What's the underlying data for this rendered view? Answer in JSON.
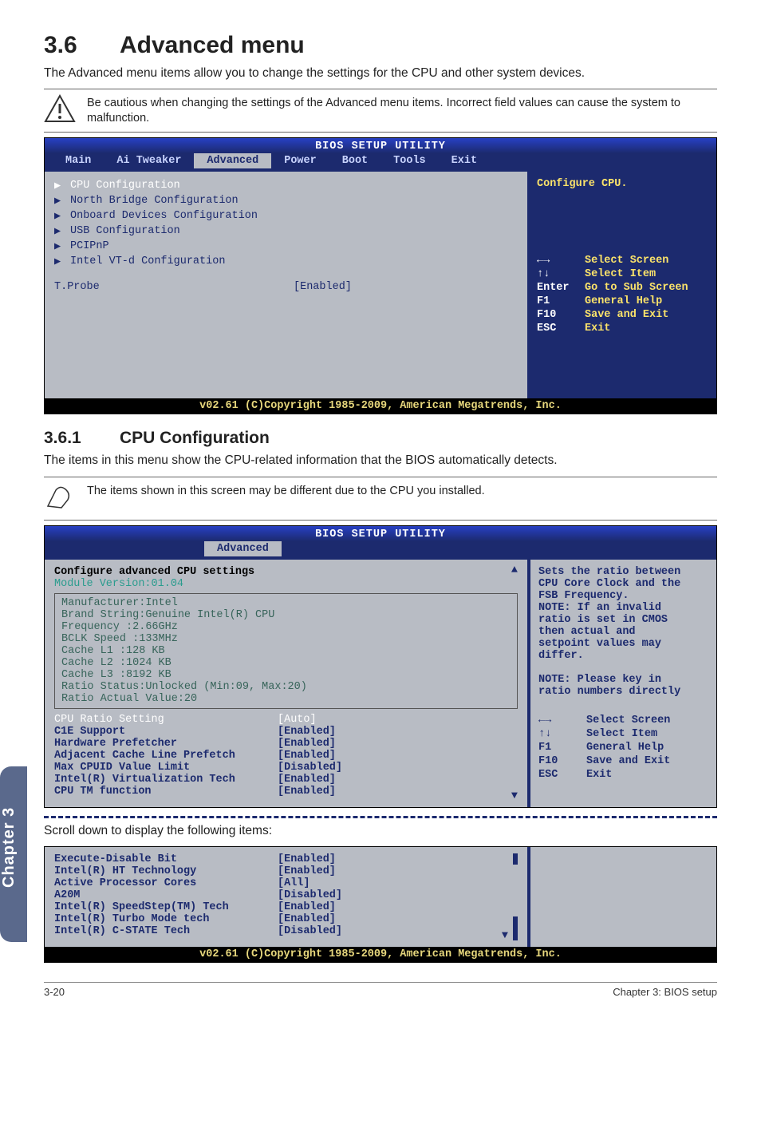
{
  "section": {
    "number": "3.6",
    "title": "Advanced menu",
    "intro": "The Advanced menu items allow you to change the settings for the CPU and other system devices.",
    "caution": "Be cautious when changing the settings of the Advanced menu items. Incorrect field values can cause the system to malfunction."
  },
  "bios1": {
    "title": "BIOS SETUP UTILITY",
    "tabs": [
      "Main",
      "Ai Tweaker",
      "Advanced",
      "Power",
      "Boot",
      "Tools",
      "Exit"
    ],
    "active_tab": "Advanced",
    "items": [
      "CPU Configuration",
      "North Bridge Configuration",
      "Onboard Devices Configuration",
      "USB Configuration",
      "PCIPnP",
      "Intel VT-d Configuration"
    ],
    "tprobe": {
      "label": "T.Probe",
      "value": "[Enabled]"
    },
    "right_help": "Configure CPU.",
    "keys": [
      {
        "k": "←→",
        "d": "Select Screen"
      },
      {
        "k": "↑↓",
        "d": "Select Item"
      },
      {
        "k": "Enter",
        "d": "Go to Sub Screen"
      },
      {
        "k": "F1",
        "d": "General Help"
      },
      {
        "k": "F10",
        "d": "Save and Exit"
      },
      {
        "k": "ESC",
        "d": "Exit"
      }
    ],
    "footer": "v02.61 (C)Copyright 1985-2009, American Megatrends, Inc."
  },
  "sub": {
    "number": "3.6.1",
    "title": "CPU Configuration",
    "intro": "The items in this menu show the CPU-related information that the BIOS automatically detects.",
    "note": "The items shown in this screen may be different due to the CPU you installed."
  },
  "chart_data": {
    "type": "table",
    "title": "BIOS Advanced / CPU Configuration settings",
    "sections": {
      "advanced_menu_items": [
        {
          "name": "CPU Configuration",
          "type": "submenu"
        },
        {
          "name": "North Bridge Configuration",
          "type": "submenu"
        },
        {
          "name": "Onboard Devices Configuration",
          "type": "submenu"
        },
        {
          "name": "USB Configuration",
          "type": "submenu"
        },
        {
          "name": "PCIPnP",
          "type": "submenu"
        },
        {
          "name": "Intel VT-d Configuration",
          "type": "submenu"
        },
        {
          "name": "T.Probe",
          "value": "Enabled"
        }
      ],
      "cpu_info": {
        "Module Version": "01.04",
        "Manufacturer": "Intel",
        "Brand String": "Genuine Intel(R) CPU",
        "Frequency": "2.66GHz",
        "BCLK Speed": "133MHz",
        "Cache L1": "128 KB",
        "Cache L2": "1024 KB",
        "Cache L3": "8192 KB",
        "Ratio Status": "Unlocked (Min:09, Max:20)",
        "Ratio Actual Value": "20"
      },
      "cpu_settings": [
        {
          "name": "CPU Ratio Setting",
          "value": "Auto"
        },
        {
          "name": "C1E Support",
          "value": "Enabled"
        },
        {
          "name": "Hardware Prefetcher",
          "value": "Enabled"
        },
        {
          "name": "Adjacent Cache Line Prefetch",
          "value": "Enabled"
        },
        {
          "name": "Max CPUID Value Limit",
          "value": "Disabled"
        },
        {
          "name": "Intel(R) Virtualization Tech",
          "value": "Enabled"
        },
        {
          "name": "CPU TM function",
          "value": "Enabled"
        },
        {
          "name": "Execute-Disable Bit",
          "value": "Enabled"
        },
        {
          "name": "Intel(R) HT Technology",
          "value": "Enabled"
        },
        {
          "name": "Active Processor Cores",
          "value": "All"
        },
        {
          "name": "A20M",
          "value": "Disabled"
        },
        {
          "name": "Intel(R) SpeedStep(TM) Tech",
          "value": "Enabled"
        },
        {
          "name": "Intel(R) Turbo Mode tech",
          "value": "Enabled"
        },
        {
          "name": "Intel(R) C-STATE Tech",
          "value": "Disabled"
        }
      ]
    }
  },
  "bios2": {
    "title": "BIOS SETUP UTILITY",
    "active_tab": "Advanced",
    "header": "Configure advanced CPU settings",
    "module": "Module Version:01.04",
    "info": [
      "Manufacturer:Intel",
      "Brand String:Genuine Intel(R) CPU",
      "Frequency   :2.66GHz",
      "BCLK Speed  :133MHz",
      "Cache L1    :128 KB",
      "Cache L2    :1024 KB",
      "Cache L3    :8192 KB",
      "Ratio Status:Unlocked (Min:09, Max:20)",
      "Ratio Actual Value:20"
    ],
    "settings": [
      {
        "k": "CPU Ratio Setting",
        "v": "[Auto]",
        "cls": "hilite"
      },
      {
        "k": "C1E Support",
        "v": "[Enabled]",
        "cls": "bold-blue"
      },
      {
        "k": "Hardware Prefetcher",
        "v": "[Enabled]",
        "cls": "bold-blue"
      },
      {
        "k": "Adjacent Cache Line Prefetch",
        "v": "[Enabled]",
        "cls": "bold-blue"
      },
      {
        "k": "Max CPUID Value Limit",
        "v": "[Disabled]",
        "cls": "bold-blue"
      },
      {
        "k": "Intel(R) Virtualization Tech",
        "v": "[Enabled]",
        "cls": "bold-blue"
      },
      {
        "k": "CPU TM function",
        "v": "[Enabled]",
        "cls": "bold-blue"
      }
    ],
    "right_help": [
      "Sets the ratio between",
      "CPU Core Clock and the",
      "FSB Frequency.",
      "NOTE: If an invalid",
      "ratio is set in CMOS",
      "then actual and",
      "setpoint values may",
      "differ.",
      "",
      "NOTE: Please key in",
      "ratio numbers directly"
    ],
    "keys": [
      {
        "k": "←→",
        "d": "Select Screen"
      },
      {
        "k": "↑↓",
        "d": "Select Item"
      },
      {
        "k": "F1",
        "d": "General Help"
      },
      {
        "k": "F10",
        "d": "Save and Exit"
      },
      {
        "k": "ESC",
        "d": "Exit"
      }
    ]
  },
  "scroll_note": "Scroll down to display the following items:",
  "bios3": {
    "settings": [
      {
        "k": "Execute-Disable Bit",
        "v": "[Enabled]"
      },
      {
        "k": "Intel(R) HT Technology",
        "v": "[Enabled]"
      },
      {
        "k": "Active Processor Cores",
        "v": "[All]"
      },
      {
        "k": "A20M",
        "v": "[Disabled]"
      },
      {
        "k": "Intel(R) SpeedStep(TM) Tech",
        "v": "[Enabled]"
      },
      {
        "k": "Intel(R) Turbo Mode tech",
        "v": "[Enabled]"
      },
      {
        "k": "Intel(R) C-STATE Tech",
        "v": "[Disabled]"
      }
    ],
    "footer": "v02.61 (C)Copyright 1985-2009, American Megatrends, Inc."
  },
  "side_tab": "Chapter 3",
  "footer": {
    "left": "3-20",
    "right": "Chapter 3: BIOS setup"
  }
}
